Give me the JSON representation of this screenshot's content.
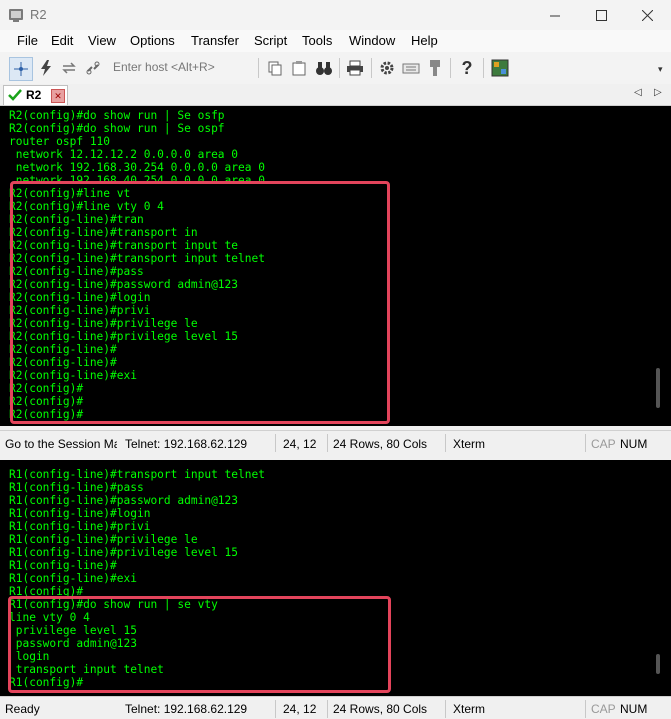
{
  "window": {
    "title": "R2",
    "minimize_icon": "minimize-icon",
    "maximize_icon": "maximize-icon",
    "close_icon": "close-icon"
  },
  "menu": [
    "File",
    "Edit",
    "View",
    "Options",
    "Transfer",
    "Script",
    "Tools",
    "Window",
    "Help"
  ],
  "toolbar": {
    "enter_host_placeholder": "Enter host <Alt+R>"
  },
  "tab": {
    "label": "R2",
    "status": "connected-check-icon",
    "close_icon": "tab-close-icon"
  },
  "terminal_top": {
    "lines": [
      "R2(config)#do show run | Se osfp",
      "R2(config)#do show run | Se ospf",
      "router ospf 110",
      " network 12.12.12.2 0.0.0.0 area 0",
      " network 192.168.30.254 0.0.0.0 area 0",
      " network 192.168.40.254 0.0.0.0 area 0",
      "R2(config)#line vt",
      "R2(config)#line vty 0 4",
      "R2(config-line)#tran",
      "R2(config-line)#transport in",
      "R2(config-line)#transport input te",
      "R2(config-line)#transport input telnet",
      "R2(config-line)#pass",
      "R2(config-line)#password admin@123",
      "R2(config-line)#login",
      "R2(config-line)#privi",
      "R2(config-line)#privilege le",
      "R2(config-line)#privilege level 15",
      "R2(config-line)#",
      "R2(config-line)#",
      "R2(config-line)#exi",
      "R2(config)#",
      "R2(config)#",
      "R2(config)#"
    ]
  },
  "status_top": {
    "session": "Go to the Session Manager",
    "telnet": "Telnet: 192.168.62.129",
    "cursor": "24,  12",
    "rows_cols": "24 Rows, 80 Cols",
    "term_type": "Xterm",
    "cap": "CAP",
    "num": "NUM"
  },
  "terminal_bottom": {
    "lines": [
      "R1(config-line)#transport input telnet",
      "R1(config-line)#pass",
      "R1(config-line)#password admin@123",
      "R1(config-line)#login",
      "R1(config-line)#privi",
      "R1(config-line)#privilege le",
      "R1(config-line)#privilege level 15",
      "R1(config-line)#",
      "R1(config-line)#exi",
      "R1(config)#",
      "R1(config)#do show run | se vty",
      "line vty 0 4",
      " privilege level 15",
      " password admin@123",
      " login",
      " transport input telnet",
      "R1(config)#"
    ]
  },
  "status_bottom": {
    "session": "Ready",
    "telnet": "Telnet: 192.168.62.129",
    "cursor": "24,  12",
    "rows_cols": "24 Rows, 80 Cols",
    "term_type": "Xterm",
    "cap": "CAP",
    "num": "NUM"
  }
}
